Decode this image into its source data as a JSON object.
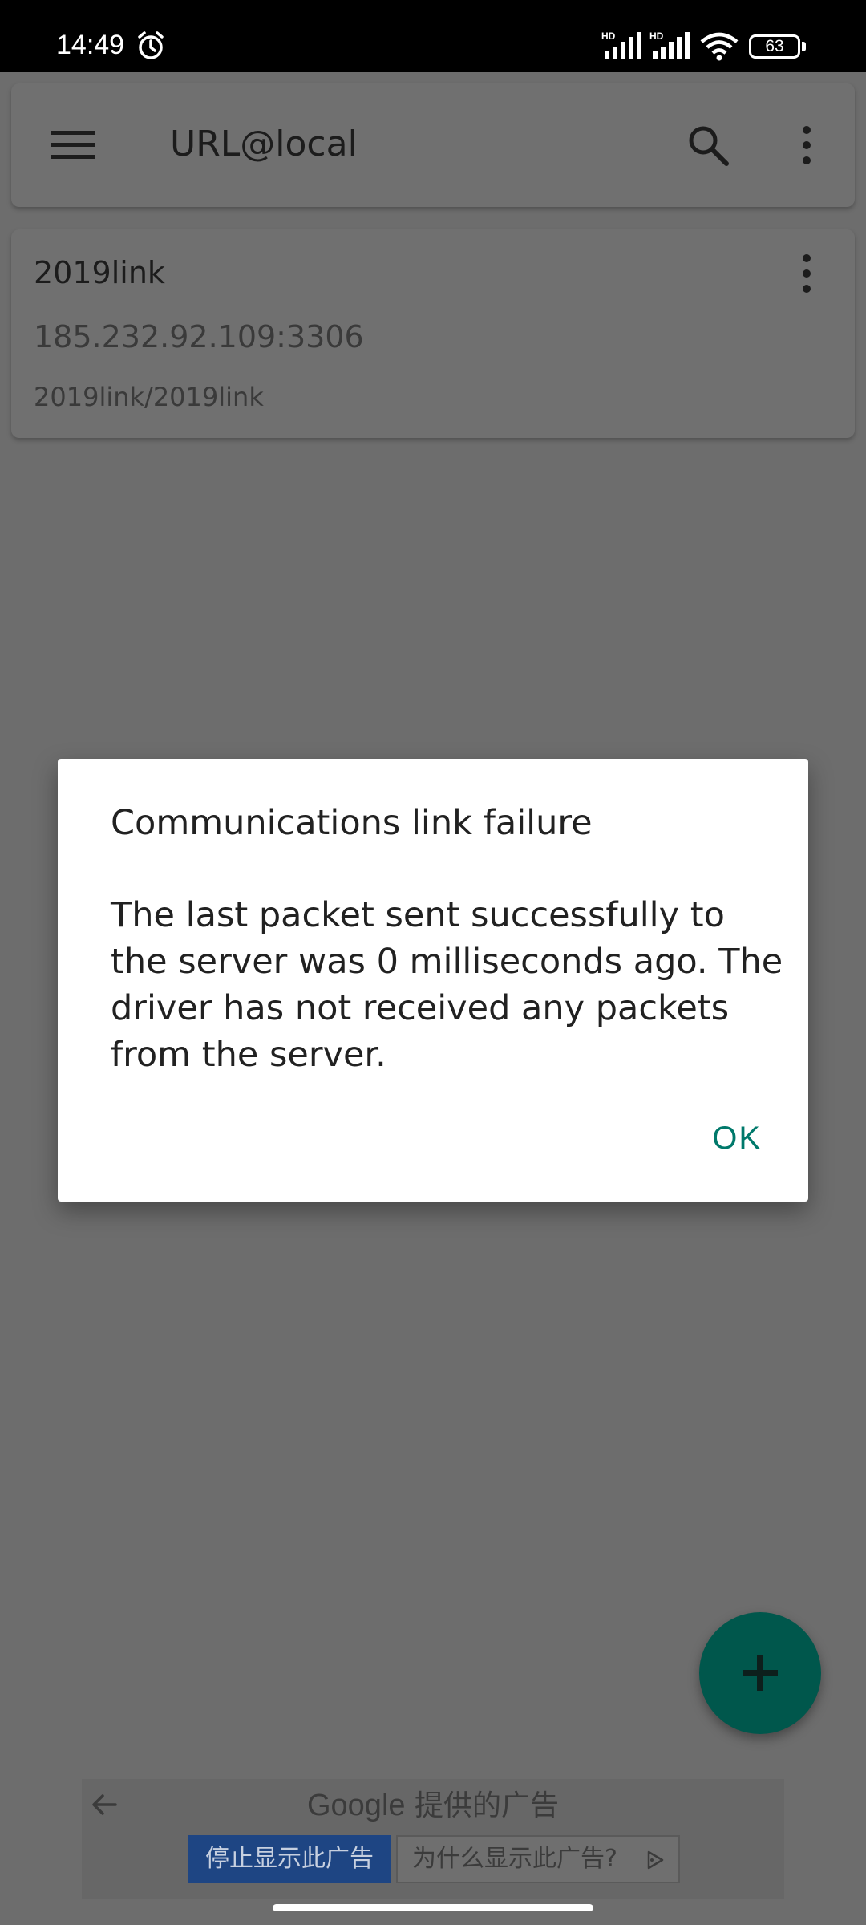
{
  "status_bar": {
    "time": "14:49",
    "battery": "63",
    "icons": [
      "alarm-icon",
      "signal-hd-icon",
      "signal-hd-icon",
      "wifi-icon",
      "battery-icon"
    ]
  },
  "toolbar": {
    "title": "URL@local",
    "icons": [
      "menu-icon",
      "search-icon",
      "more-vert-icon"
    ]
  },
  "connection": {
    "name": "2019link",
    "host": "185.232.92.109:3306",
    "database": "2019link/2019link"
  },
  "dialog": {
    "title": "Communications link failure",
    "message": "The last packet sent successfully to the server was 0 milliseconds ago. The driver has not received any packets from the server.",
    "ok_label": "OK",
    "accent_color": "#00796b"
  },
  "fab": {
    "icon": "plus-icon",
    "color": "#00574c"
  },
  "ad": {
    "google": "Google",
    "label": "提供的广告",
    "stop_label": "停止显示此广告",
    "why_label": "为什么显示此广告?"
  }
}
